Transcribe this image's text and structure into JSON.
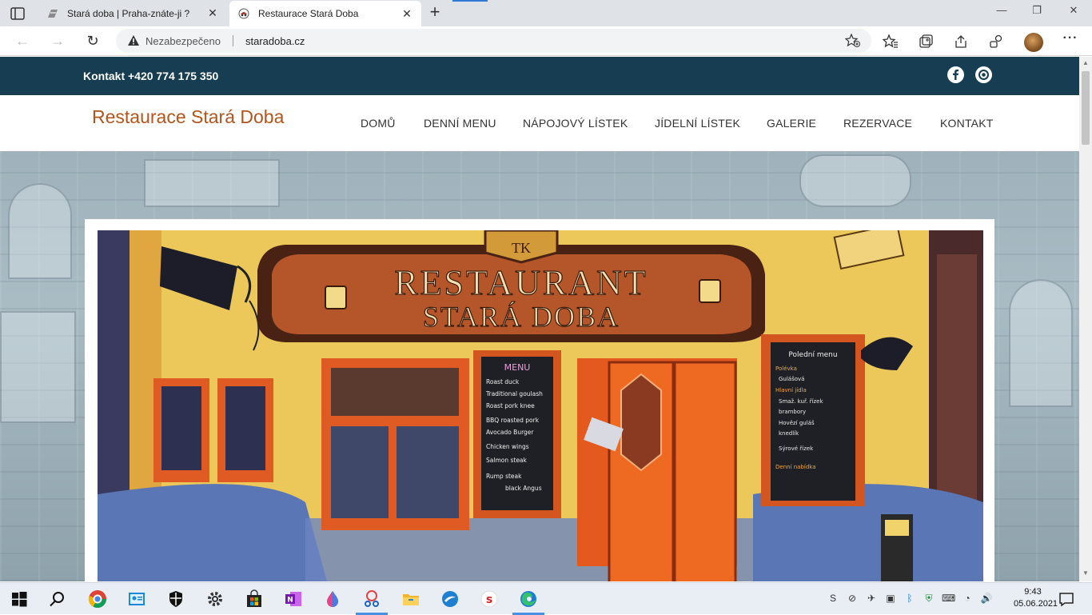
{
  "browser": {
    "tabs": [
      {
        "title": "Stará doba | Praha-znáte-ji ?",
        "active": false
      },
      {
        "title": "Restaurace Stará Doba",
        "active": true
      }
    ],
    "new_tab_label": "+",
    "security_label": "Nezabezpečeno",
    "url": "staradoba.cz",
    "accent_color": "#2f7ad7"
  },
  "site": {
    "contact": "Kontakt +420 774 175 350",
    "social": [
      "facebook-icon",
      "instagram-icon"
    ],
    "brand": "Restaurace Stará Doba",
    "brand_color": "#b2541c",
    "strip_color": "#163d52",
    "menu": [
      "DOMŮ",
      "DENNÍ MENU",
      "NÁPOJOVÝ LÍSTEK",
      "JÍDELNÍ LÍSTEK",
      "GALERIE",
      "REZERVACE",
      "KONTAKT"
    ]
  },
  "photo": {
    "sign_line1": "RESTAURANT",
    "sign_line2": "STARÁ DOBA",
    "emblem": "TK",
    "board_left_title": "MENU",
    "board_left_items": [
      "Roast duck",
      "Traditional goulash",
      "Roast pork knee",
      "BBQ roasted pork",
      "Avocado Burger",
      "Chicken wings",
      "Salmon steak",
      "Rump steak",
      "black Angus"
    ],
    "board_right_title": "Polední menu",
    "board_right_items": [
      "Polévka",
      "Gulášová",
      "Hlavní jídla",
      "Smaž. kuř. řízek",
      "brambory",
      "Hovězí guláš",
      "knedlík",
      "Sýrové řízek",
      "Denní nabídka"
    ]
  },
  "taskbar": {
    "time": "9:43",
    "date": "05.06.2021",
    "apps": [
      "start-icon",
      "search-icon",
      "chrome-icon",
      "contacts-icon",
      "security-icon",
      "settings-icon",
      "store-icon",
      "onenote-icon",
      "droplet-icon",
      "snipping-icon",
      "explorer-icon",
      "swift-icon",
      "s-app-icon",
      "edge-icon"
    ]
  }
}
